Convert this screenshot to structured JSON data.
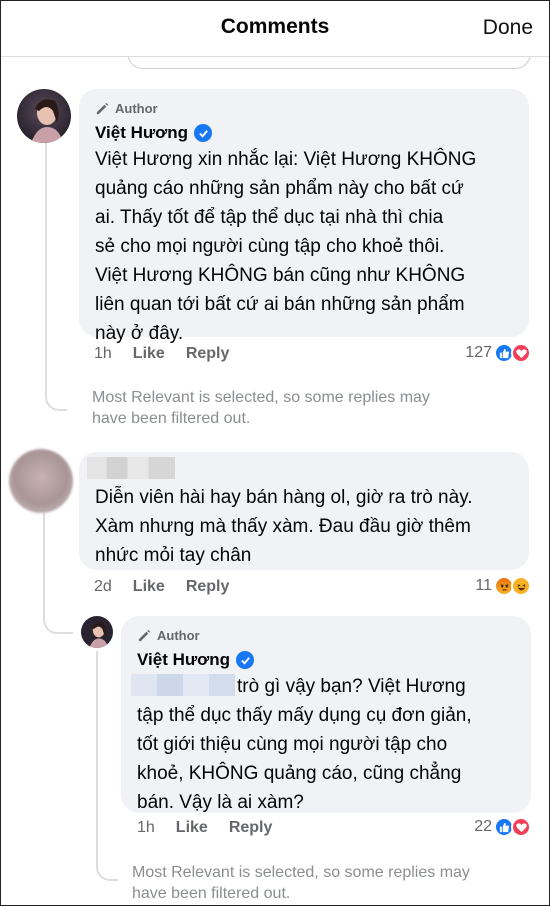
{
  "header": {
    "title": "Comments",
    "done_label": "Done"
  },
  "comments": [
    {
      "author_tag": "Author",
      "name": "Việt Hương",
      "text": "Việt Hương xin nhắc lại: Việt Hương KHÔNG\nquảng cáo những sản phẩm này cho bất cứ\nai. Thấy tốt để tập thể dục tại nhà thì chia\nsẻ cho mọi người cùng tập cho khoẻ thôi.\nViệt Hương KHÔNG bán cũng như KHÔNG\nliên quan tới bất cứ ai bán những sản phẩm\nnày ở đây.",
      "time": "1h",
      "like_label": "Like",
      "reply_label": "Reply",
      "reaction_count": "127",
      "reactions": [
        "like-icon",
        "love-icon"
      ],
      "notice": "Most Relevant is selected, so some replies may\nhave been filtered out."
    },
    {
      "text": "Diễn viên hài hay bán hàng ol, giờ ra trò này.\nXàm nhưng mà thấy xàm. Đau đầu giờ thêm\nnhức mỏi tay chân",
      "time": "2d",
      "like_label": "Like",
      "reply_label": "Reply",
      "reaction_count": "11",
      "reactions": [
        "angry-icon",
        "haha-icon"
      ]
    },
    {
      "author_tag": "Author",
      "name": "Việt Hương",
      "text": "trò gì vậy bạn? Việt Hương\ntập thể dục thấy mấy dụng cụ đơn giản,\ntốt giới thiệu cùng mọi người tập cho\nkhoẻ, KHÔNG quảng cáo, cũng chẳng\nbán. Vậy là ai xàm?",
      "time": "1h",
      "like_label": "Like",
      "reply_label": "Reply",
      "reaction_count": "22",
      "reactions": [
        "like-icon",
        "love-icon"
      ],
      "notice": "Most Relevant is selected, so some replies may\nhave been filtered out."
    }
  ],
  "colors": {
    "like": "#1877f2",
    "love": "#f33e58",
    "angry": "#e9710f",
    "haha": "#f7b125",
    "verified": "#1877f2"
  }
}
